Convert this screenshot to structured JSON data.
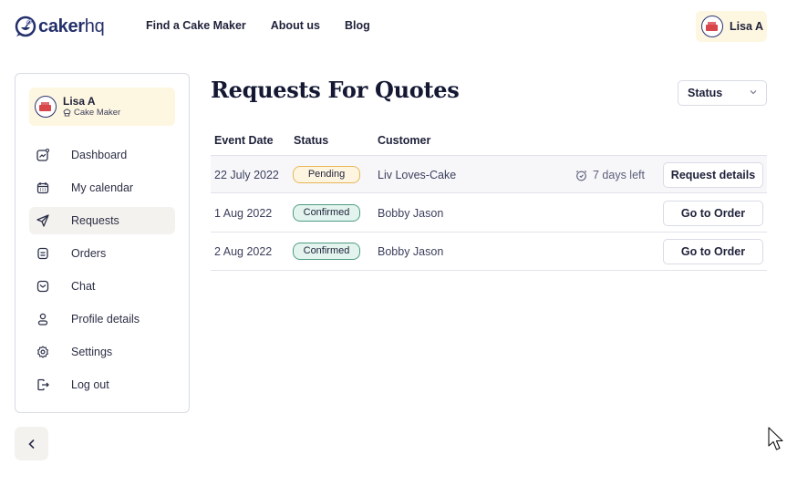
{
  "header": {
    "logo": {
      "bold": "caker",
      "light": "hq",
      "icon": "whisk-chat-logo-icon"
    },
    "nav": [
      {
        "label": "Find a Cake Maker"
      },
      {
        "label": "About us"
      },
      {
        "label": "Blog"
      }
    ],
    "user": {
      "name": "Lisa A",
      "avatar": "cake-avatar"
    }
  },
  "sidebar": {
    "profile": {
      "name": "Lisa A",
      "role": "Cake Maker",
      "role_icon": "chef-hat-icon"
    },
    "items": [
      {
        "label": "Dashboard",
        "icon": "dashboard-chart-icon",
        "active": false
      },
      {
        "label": "My calendar",
        "icon": "calendar-icon",
        "active": false
      },
      {
        "label": "Requests",
        "icon": "send-icon",
        "active": true
      },
      {
        "label": "Orders",
        "icon": "document-icon",
        "active": false
      },
      {
        "label": "Chat",
        "icon": "chat-icon",
        "active": false
      },
      {
        "label": "Profile details",
        "icon": "user-icon",
        "active": false
      },
      {
        "label": "Settings",
        "icon": "gear-icon",
        "active": false
      },
      {
        "label": "Log out",
        "icon": "logout-icon",
        "active": false
      }
    ],
    "collapse_icon": "chevron-left-icon"
  },
  "main": {
    "title": "Requests For Quotes",
    "filter": {
      "selected": "Status",
      "icon": "chevron-down-icon"
    },
    "table": {
      "columns": [
        "Event Date",
        "Status",
        "Customer"
      ],
      "rows": [
        {
          "date": "22 July 2022",
          "status": "Pending",
          "customer": "Liv Loves-Cake",
          "time_left": "7 days left",
          "action": "Request details"
        },
        {
          "date": "1 Aug 2022",
          "status": "Confirmed",
          "customer": "Bobby Jason",
          "time_left": "",
          "action": "Go to Order"
        },
        {
          "date": "2 Aug 2022",
          "status": "Confirmed",
          "customer": "Bobby Jason",
          "time_left": "",
          "action": "Go to Order"
        }
      ]
    }
  },
  "colors": {
    "brand_navy": "#24306b",
    "chip_bg": "#fdf6e0",
    "active_item_bg": "#f4f2ee",
    "pending_border": "#e8b65a",
    "confirmed_border": "#4f9b84"
  }
}
